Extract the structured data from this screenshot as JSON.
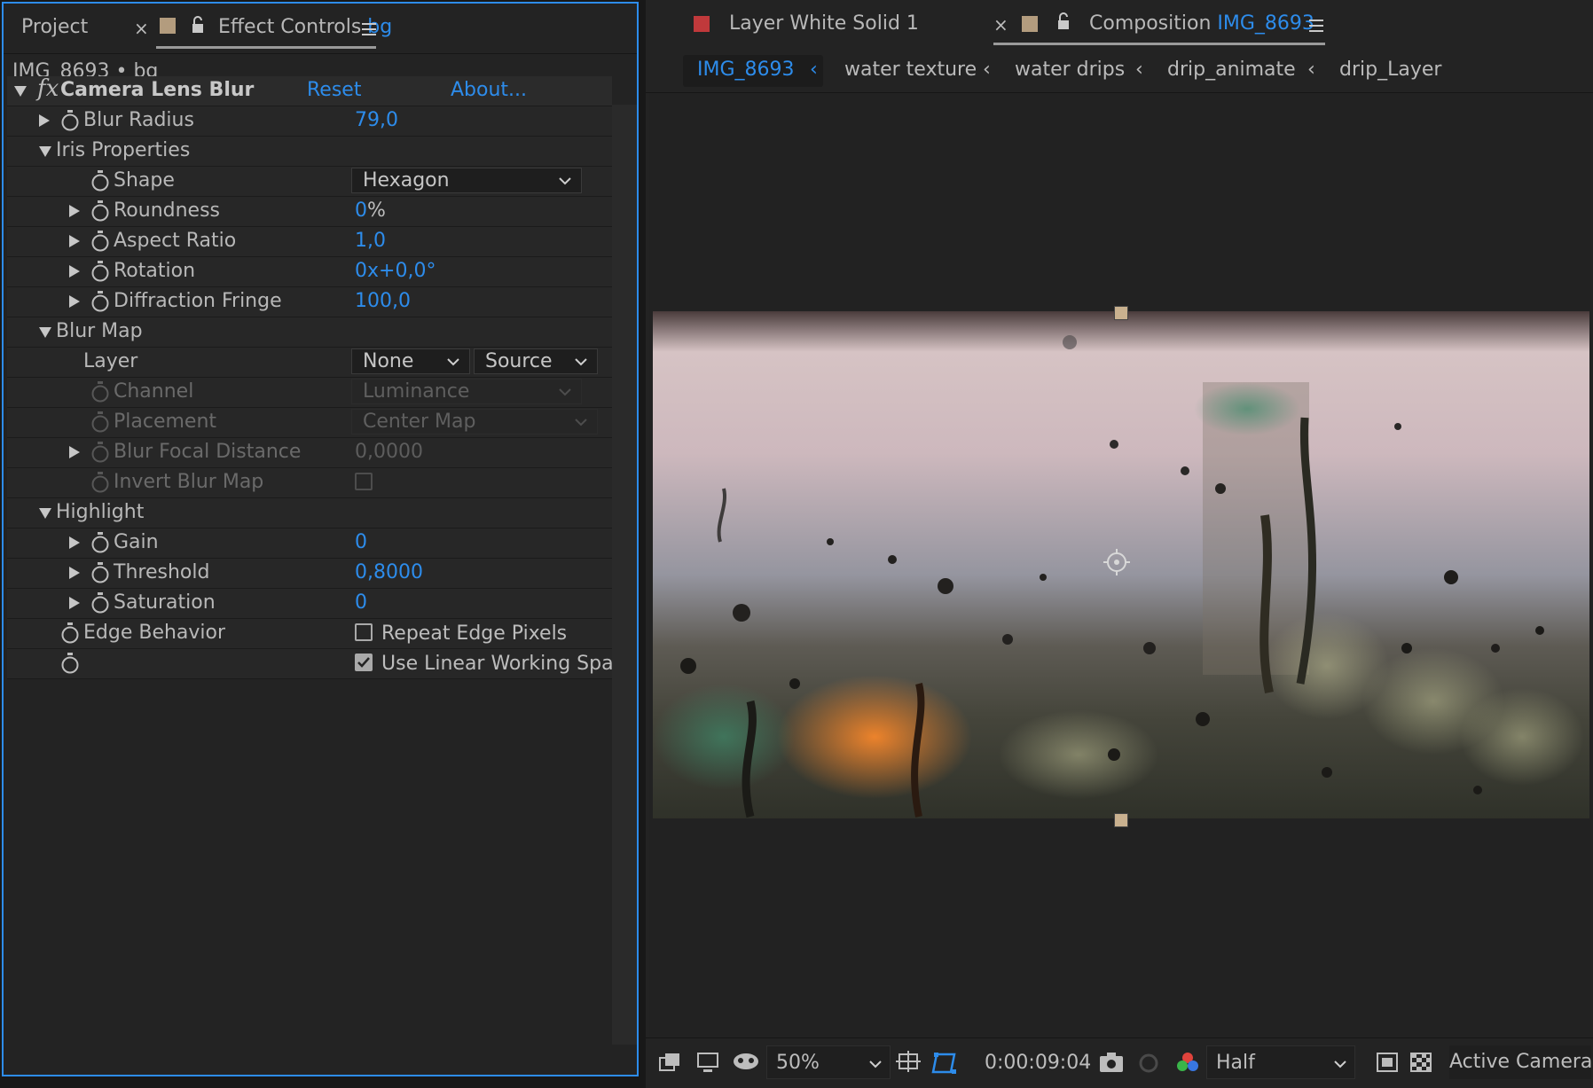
{
  "left_panel": {
    "tab_project": "Project",
    "tab_effect_controls": "Effect Controls",
    "tab_effect_controls_layer": "bg",
    "layer_title": "IMG_8693 • bg",
    "effect": {
      "name": "Camera Lens Blur",
      "reset": "Reset",
      "about": "About...",
      "blur_radius": {
        "label": "Blur Radius",
        "value": "79,0"
      },
      "iris_properties": "Iris Properties",
      "shape": {
        "label": "Shape",
        "value": "Hexagon"
      },
      "roundness": {
        "label": "Roundness",
        "value": "0",
        "unit": "%"
      },
      "aspect_ratio": {
        "label": "Aspect Ratio",
        "value": "1,0"
      },
      "rotation": {
        "label": "Rotation",
        "value": "0x+0,0°"
      },
      "diffraction_fringe": {
        "label": "Diffraction Fringe",
        "value": "100,0"
      },
      "blur_map": "Blur Map",
      "layer": {
        "label": "Layer",
        "value": "None",
        "source": "Source"
      },
      "channel": {
        "label": "Channel",
        "value": "Luminance"
      },
      "placement": {
        "label": "Placement",
        "value": "Center Map"
      },
      "blur_focal_distance": {
        "label": "Blur Focal Distance",
        "value": "0,0000"
      },
      "invert_blur_map": {
        "label": "Invert Blur Map"
      },
      "highlight": "Highlight",
      "gain": {
        "label": "Gain",
        "value": "0"
      },
      "threshold": {
        "label": "Threshold",
        "value": "0,8000"
      },
      "saturation": {
        "label": "Saturation",
        "value": "0"
      },
      "edge_behavior": {
        "label": "Edge Behavior",
        "checkbox_label": "Repeat Edge Pixels",
        "checked": false
      },
      "linear_working": {
        "checkbox_label": "Use Linear Working Spac",
        "checked": true
      }
    }
  },
  "right_panel": {
    "tab_layer": "Layer White Solid 1",
    "tab_composition": "Composition",
    "tab_composition_name": "IMG_8693",
    "breadcrumbs": [
      "IMG_8693",
      "water texture",
      "water drips",
      "drip_animate",
      "drip_Layer"
    ],
    "toolbar": {
      "zoom": "50%",
      "timecode": "0:00:09:04",
      "resolution": "Half",
      "camera": "Active Camera"
    }
  },
  "colors": {
    "accent": "#2d8ceb",
    "panel_bg": "#232323",
    "layer_swatch_red": "#c0393b",
    "swatch_tan": "#b39c7e"
  }
}
